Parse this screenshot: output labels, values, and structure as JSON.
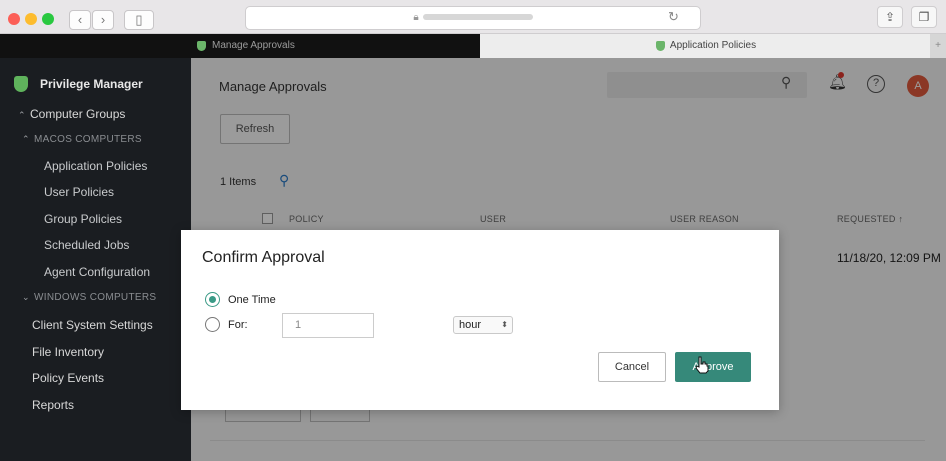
{
  "browser": {
    "url_text": "a",
    "tabs": [
      {
        "label": "Manage Approvals"
      },
      {
        "label": "Application Policies"
      }
    ],
    "new_tab": "+"
  },
  "sidebar": {
    "brand": "Privilege Manager",
    "items": [
      {
        "label": "Computer Groups"
      },
      {
        "label": "MACOS COMPUTERS"
      },
      {
        "label": "Application Policies"
      },
      {
        "label": "User Policies"
      },
      {
        "label": "Group Policies"
      },
      {
        "label": "Scheduled Jobs"
      },
      {
        "label": "Agent Configuration"
      },
      {
        "label": "WINDOWS COMPUTERS"
      },
      {
        "label": "Client System Settings"
      },
      {
        "label": "File Inventory"
      },
      {
        "label": "Policy Events"
      },
      {
        "label": "Reports"
      }
    ]
  },
  "main": {
    "title": "Manage Approvals",
    "avatar_initial": "A",
    "help_glyph": "?",
    "refresh_label": "Refresh",
    "items_count": "1 Items",
    "columns": [
      "POLICY",
      "USER",
      "USER REASON",
      "REQUESTED ↑"
    ],
    "requested_date": "11/18/20, 12:09 PM"
  },
  "modal": {
    "title": "Confirm Approval",
    "option_one_time": "One Time",
    "option_for": "For:",
    "duration_value": "1",
    "unit_value": "hour",
    "unit_arrow": "⬍",
    "cancel_label": "Cancel",
    "approve_label": "Approve"
  },
  "colors": {
    "accent": "#36897a",
    "sidebar_bg": "#1a1d21",
    "brand_green": "#5fb35c"
  }
}
